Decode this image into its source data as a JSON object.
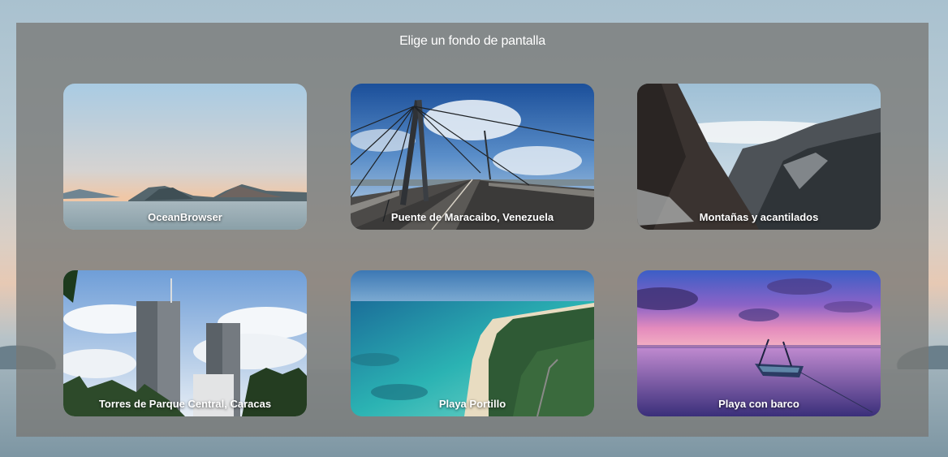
{
  "dialog": {
    "title": "Elige un fondo de pantalla"
  },
  "wallpapers": [
    {
      "label": "OceanBrowser"
    },
    {
      "label": "Puente de Maracaibo, Venezuela"
    },
    {
      "label": "Montañas y acantilados"
    },
    {
      "label": "Torres de Parque Central, Caracas"
    },
    {
      "label": "Playa Portillo"
    },
    {
      "label": "Playa con barco"
    }
  ],
  "colors": {
    "overlay": "#787876",
    "label_text": "#ffffff"
  }
}
